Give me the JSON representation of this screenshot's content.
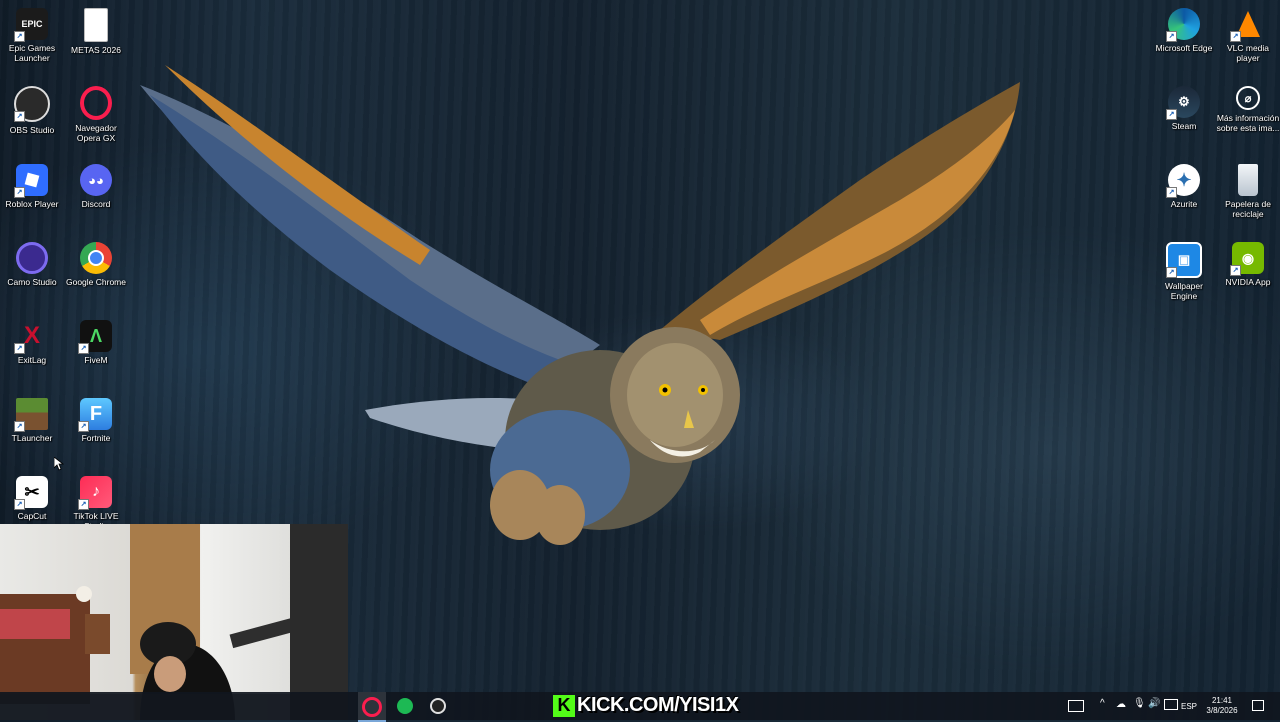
{
  "desktop": {
    "left_icons": [
      {
        "label": "Epic Games Launcher",
        "icon": "epic-games-icon",
        "color": "#1b1b1b"
      },
      {
        "label": "METAS 2026",
        "icon": "text-document-icon",
        "color": "#ffffff"
      },
      {
        "label": "OBS Studio",
        "icon": "obs-studio-icon",
        "color": "#1e1e1e"
      },
      {
        "label": "Navegador Opera GX",
        "icon": "opera-gx-icon",
        "color": "#fa1e4e"
      },
      {
        "label": "Roblox Player",
        "icon": "roblox-icon",
        "color": "#2f6dff"
      },
      {
        "label": "Discord",
        "icon": "discord-icon",
        "color": "#5865f2"
      },
      {
        "label": "Camo Studio",
        "icon": "camo-studio-icon",
        "color": "#3b2a8f"
      },
      {
        "label": "Google Chrome",
        "icon": "chrome-icon",
        "color": "#4285f4"
      },
      {
        "label": "ExitLag",
        "icon": "exitlag-icon",
        "color": "#c8102e"
      },
      {
        "label": "FiveM",
        "icon": "fivem-icon",
        "color": "#111111"
      },
      {
        "label": "TLauncher",
        "icon": "tlauncher-icon",
        "color": "#5b8c32"
      },
      {
        "label": "Fortnite",
        "icon": "fortnite-icon",
        "color": "#3cb4ff"
      },
      {
        "label": "CapCut",
        "icon": "capcut-icon",
        "color": "#ffffff"
      },
      {
        "label": "TikTok LIVE Studio",
        "icon": "tiktok-live-icon",
        "color": "#fe2c55"
      }
    ],
    "right_icons": [
      {
        "label": "Microsoft Edge",
        "icon": "edge-icon",
        "color": "#1fa1e0"
      },
      {
        "label": "VLC media player",
        "icon": "vlc-icon",
        "color": "#ff8800"
      },
      {
        "label": "Steam",
        "icon": "steam-icon",
        "color": "#1b2838"
      },
      {
        "label": "Más información sobre esta ima...",
        "icon": "info-camera-icon",
        "color": "#333333"
      },
      {
        "label": "Azurite",
        "icon": "azurite-icon",
        "color": "#2a6fb0"
      },
      {
        "label": "Papelera de reciclaje",
        "icon": "recycle-bin-icon",
        "color": "#dfe6ee"
      },
      {
        "label": "Wallpaper Engine",
        "icon": "wallpaper-engine-icon",
        "color": "#1e88e5"
      },
      {
        "label": "NVIDIA App",
        "icon": "nvidia-icon",
        "color": "#76b900"
      }
    ]
  },
  "overlay": {
    "kick_text": "KICK.COM/YISI1X",
    "kick_logo": "K"
  },
  "taskbar": {
    "pinned": [
      {
        "name": "opera-gx-taskbar-icon",
        "color": "#fa1e4e"
      },
      {
        "name": "spotify-taskbar-icon",
        "color": "#1db954"
      },
      {
        "name": "obs-taskbar-icon",
        "color": "#e0e0e0"
      }
    ],
    "language": "ESP",
    "time": "21:41",
    "date": "3/8/2026"
  }
}
